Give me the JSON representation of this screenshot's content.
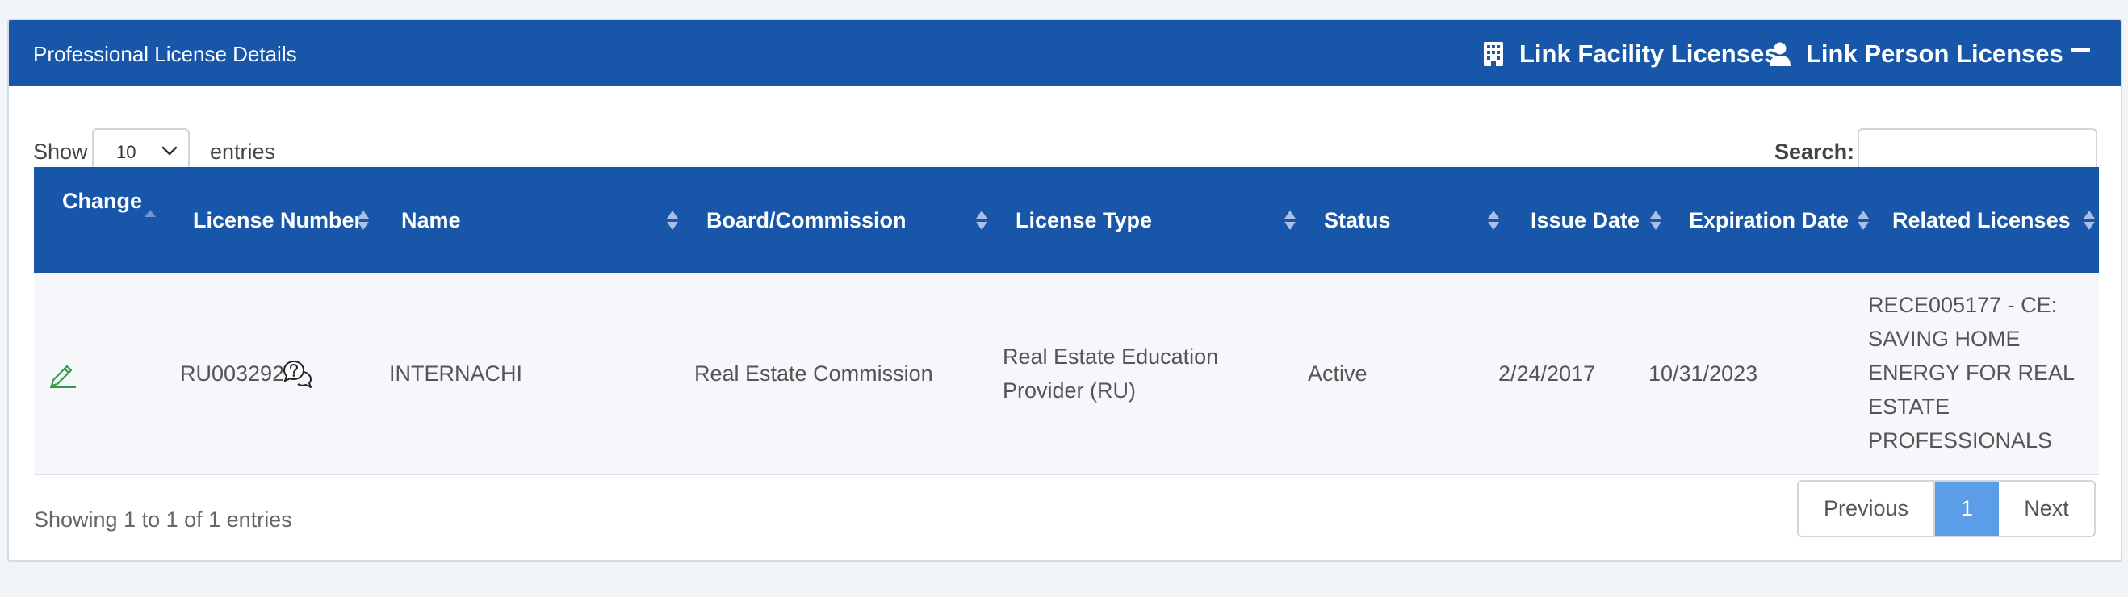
{
  "panel": {
    "title": "Professional License Details",
    "link_facility_label": "Link Facility Licenses",
    "link_person_label": "Link Person Licenses",
    "collapse_icon": "minus-icon",
    "facility_icon": "building-icon",
    "person_icon": "user-icon"
  },
  "controls": {
    "show_label": "Show",
    "page_length": "10",
    "entries_label": "entries",
    "search_label": "Search:",
    "search_value": ""
  },
  "table": {
    "columns": [
      "Change",
      "License Number",
      "Name",
      "Board/Commission",
      "License Type",
      "Status",
      "Issue Date",
      "Expiration Date",
      "Related Licenses"
    ],
    "sorted_column": "Change",
    "rows": [
      {
        "change_icon": "pencil-icon",
        "license_number": "RU003292",
        "info_icon": "question-chat-icon",
        "name": "INTERNACHI",
        "board": "Real Estate Commission",
        "license_type": [
          "Real Estate Education",
          "Provider (RU)"
        ],
        "status": "Active",
        "issue_date": "2/24/2017",
        "expiration_date": "10/31/2023",
        "related": [
          "RECE005177 - CE:",
          "SAVING HOME",
          "ENERGY FOR REAL",
          "ESTATE",
          "PROFESSIONALS"
        ]
      }
    ]
  },
  "footer": {
    "info": "Showing 1 to 1 of 1 entries",
    "prev_label": "Previous",
    "current_page": "1",
    "next_label": "Next"
  },
  "colors": {
    "header_blue": "#1756a9",
    "active_page": "#5b9de6",
    "edit_green": "#2e9e3e"
  }
}
